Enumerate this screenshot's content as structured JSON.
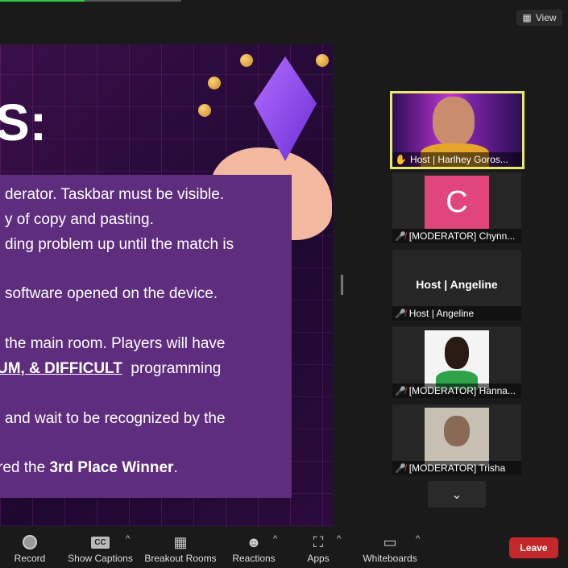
{
  "top": {
    "view_label": "View"
  },
  "slide": {
    "heading": "S:",
    "lines": [
      {
        "text": "derator. Taskbar must be visible."
      },
      {
        "text": "y of copy and pasting."
      },
      {
        "text": "ding problem up until the match is"
      },
      {
        "text": " software opened on the device."
      },
      {
        "text": " the main room. Players will have"
      },
      {
        "pre": "UM,  & DIFFICULT",
        "post": "  programming"
      },
      {
        "text": " and wait to be recognized by the"
      },
      {
        "pre": "red the ",
        "bold": "3rd Place Winner",
        "post": "."
      }
    ]
  },
  "participants": [
    {
      "name": "Host | Harlhey Goros...",
      "type": "video",
      "active": true
    },
    {
      "name": "[MODERATOR] Chynn...",
      "type": "avatar",
      "initial": "C",
      "avatar_color": "#e0457b"
    },
    {
      "name": "Host | Angeline",
      "type": "text",
      "display": "Host | Angeline"
    },
    {
      "name": "[MODERATOR] Hanna...",
      "type": "video"
    },
    {
      "name": "[MODERATOR] Trisha",
      "type": "video"
    }
  ],
  "toolbar": {
    "record": "Record",
    "captions": "Show Captions",
    "breakout": "Breakout Rooms",
    "reactions": "Reactions",
    "apps": "Apps",
    "whiteboards": "Whiteboards",
    "leave": "Leave",
    "cc": "CC"
  }
}
